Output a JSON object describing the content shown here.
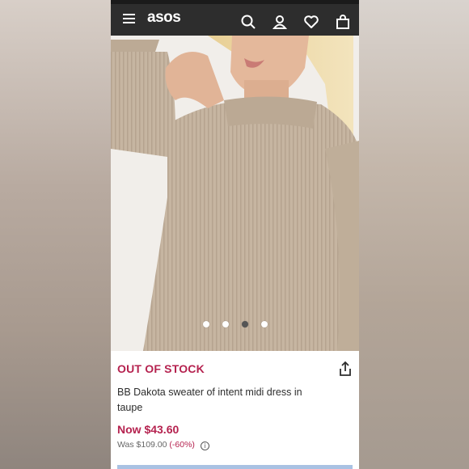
{
  "header": {
    "logo": "asos",
    "icons": [
      "menu-icon",
      "search-icon",
      "account-icon",
      "heart-icon",
      "bag-icon"
    ]
  },
  "gallery": {
    "total_images": 4,
    "active_index": 2
  },
  "product": {
    "stock_status": "OUT OF STOCK",
    "title": "BB Dakota sweater of intent midi dress in taupe",
    "now_price": "Now $43.60",
    "was_price": "Was $109.00",
    "discount": "(-60%)"
  },
  "colors": {
    "brand_accent": "#b5224f",
    "header_bg": "#2d2d2d",
    "sweater": "#c9b8a4"
  }
}
